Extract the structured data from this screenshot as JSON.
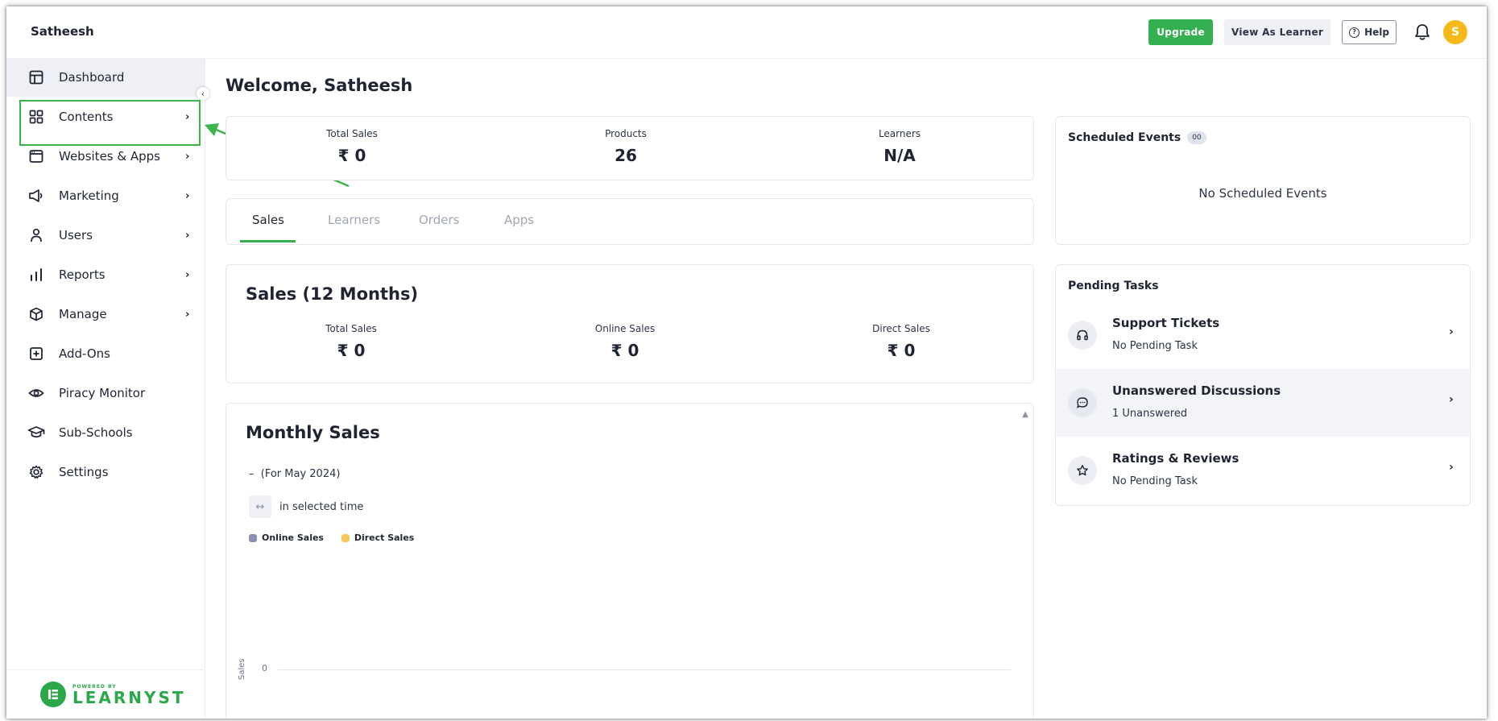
{
  "brand": "Satheesh",
  "header": {
    "upgrade_label": "Upgrade",
    "view_as_learner_label": "View As Learner",
    "help_label": "Help",
    "avatar_initial": "S"
  },
  "sidebar": {
    "items": [
      {
        "label": "Dashboard",
        "icon": "dashboard-icon"
      },
      {
        "label": "Contents",
        "icon": "grid-icon"
      },
      {
        "label": "Websites & Apps",
        "icon": "browser-window-icon"
      },
      {
        "label": "Marketing",
        "icon": "megaphone-icon"
      },
      {
        "label": "Users",
        "icon": "user-icon"
      },
      {
        "label": "Reports",
        "icon": "bar-chart-icon"
      },
      {
        "label": "Manage",
        "icon": "cube-icon"
      },
      {
        "label": "Add-Ons",
        "icon": "plus-box-icon"
      },
      {
        "label": "Piracy Monitor",
        "icon": "eye-icon"
      },
      {
        "label": "Sub-Schools",
        "icon": "graduation-cap-icon"
      },
      {
        "label": "Settings",
        "icon": "gear-icon"
      }
    ],
    "footer": {
      "powered_by": "POWERED BY",
      "logo_text": "LEARNYST"
    }
  },
  "main": {
    "welcome": "Welcome, Satheesh",
    "summary": [
      {
        "label": "Total Sales",
        "value": "₹ 0"
      },
      {
        "label": "Products",
        "value": "26"
      },
      {
        "label": "Learners",
        "value": "N/A"
      }
    ],
    "tabs": [
      "Sales",
      "Learners",
      "Orders",
      "Apps"
    ],
    "sales_card": {
      "title": "Sales (12 Months)",
      "stats": [
        {
          "label": "Total Sales",
          "value": "₹ 0"
        },
        {
          "label": "Online Sales",
          "value": "₹ 0"
        },
        {
          "label": "Direct Sales",
          "value": "₹ 0"
        }
      ]
    },
    "monthly": {
      "title": "Monthly Sales",
      "period_dash": "–",
      "period": "(For May 2024)",
      "selected_time": "in selected time",
      "legend": [
        {
          "label": "Online Sales",
          "color": "#8b8fb8"
        },
        {
          "label": "Direct Sales",
          "color": "#f7c85a"
        }
      ],
      "y_axis_label": "Sales",
      "y_tick": "0"
    }
  },
  "right": {
    "events": {
      "title": "Scheduled Events",
      "count": "00",
      "empty": "No Scheduled Events"
    },
    "pending": {
      "title": "Pending Tasks",
      "tasks": [
        {
          "title": "Support Tickets",
          "sub": "No Pending Task",
          "icon": "headphones-icon"
        },
        {
          "title": "Unanswered Discussions",
          "sub": "1 Unanswered",
          "icon": "chat-bubble-icon"
        },
        {
          "title": "Ratings & Reviews",
          "sub": "No Pending Task",
          "icon": "star-icon"
        }
      ]
    }
  },
  "colors": {
    "accent": "#34b050",
    "avatar": "#f7b81a",
    "highlight": "#3bb54a"
  }
}
